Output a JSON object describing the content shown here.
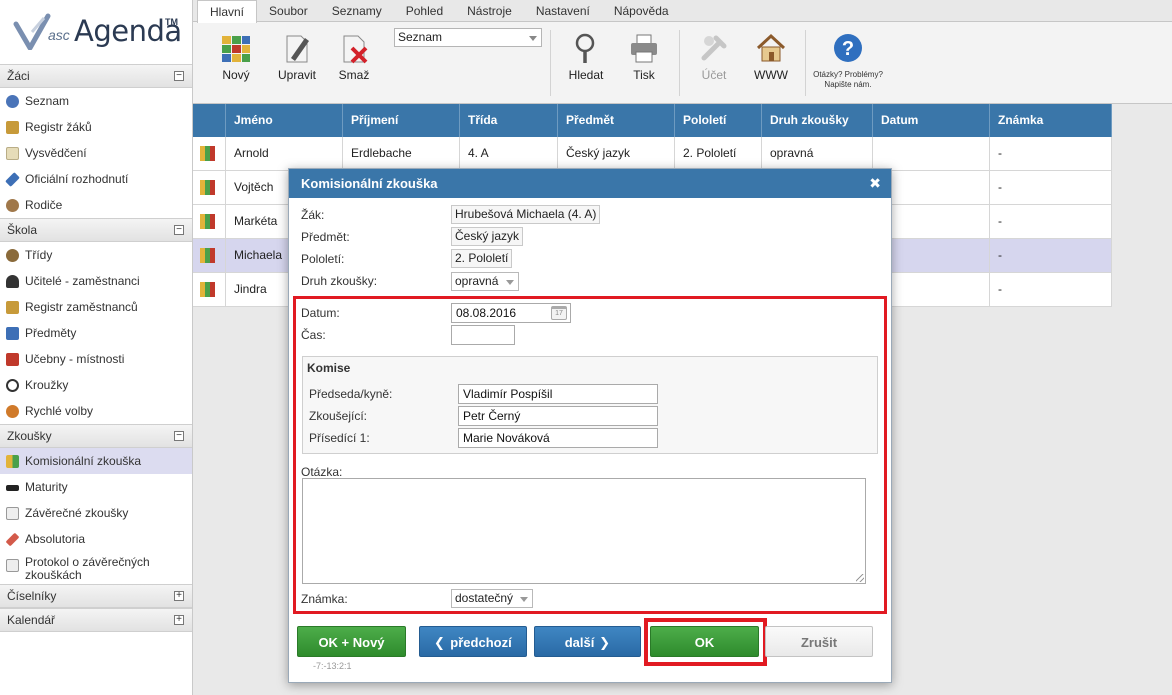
{
  "logo": {
    "asc": "asc",
    "agenda": "Agenda",
    "tm": "TM"
  },
  "sidebar": {
    "sections": [
      {
        "title": "Žáci",
        "toggle": "−",
        "items": [
          "Seznam",
          "Registr žáků",
          "Vysvědčení",
          "Oficiální rozhodnutí",
          "Rodiče"
        ]
      },
      {
        "title": "Škola",
        "toggle": "−",
        "items": [
          "Třídy",
          "Učitelé - zaměstnanci",
          "Registr zaměstnanců",
          "Předměty",
          "Učebny - místnosti",
          "Kroužky",
          "Rychlé volby"
        ]
      },
      {
        "title": "Zkoušky",
        "toggle": "−",
        "items": [
          "Komisionální zkouška",
          "Maturity",
          "Závěrečné zkoušky",
          "Absolutoria",
          "Protokol o závěrečných zkouškách"
        ]
      },
      {
        "title": "Číselníky",
        "toggle": "+",
        "items": []
      },
      {
        "title": "Kalendář",
        "toggle": "+",
        "items": []
      }
    ]
  },
  "menu": {
    "tabs": [
      "Hlavní",
      "Soubor",
      "Seznamy",
      "Pohled",
      "Nástroje",
      "Nastavení",
      "Nápověda"
    ]
  },
  "toolbar": {
    "new": "Nový",
    "edit": "Upravit",
    "delete": "Smaž",
    "view_select": "Seznam",
    "search": "Hledat",
    "print": "Tisk",
    "account": "Účet",
    "www": "WWW",
    "help_text": "Otázky? Problémy? Napište nám."
  },
  "grid": {
    "headers": [
      "",
      "Jméno",
      "Příjmení",
      "Třída",
      "Předmět",
      "Pololetí",
      "Druh zkoušky",
      "Datum",
      "Známka"
    ],
    "rows": [
      [
        "",
        "Arnold",
        "Erdlebache",
        "4. A",
        "Český jazyk",
        "2. Pololetí",
        "opravná",
        "",
        "-"
      ],
      [
        "",
        "Vojtěch",
        "",
        "",
        "",
        "",
        "",
        "",
        "-"
      ],
      [
        "",
        "Markéta",
        "",
        "",
        "",
        "",
        "",
        "",
        "-"
      ],
      [
        "",
        "Michaela",
        "",
        "",
        "",
        "",
        "",
        "",
        "-"
      ],
      [
        "",
        "Jindra",
        "",
        "",
        "",
        "",
        "",
        "",
        "-"
      ]
    ]
  },
  "dialog": {
    "title": "Komisionální zkouška",
    "close": "✖",
    "zak_label": "Žák:",
    "zak_value": "Hrubešová Michaela (4. A)",
    "predmet_label": "Předmět:",
    "predmet_value": "Český jazyk",
    "pololeti_label": "Pololetí:",
    "pololeti_value": "2. Pololetí",
    "druh_label": "Druh zkoušky:",
    "druh_value": "opravná",
    "datum_label": "Datum:",
    "datum_value": "08.08.2016",
    "cal_day": "17",
    "cas_label": "Čas:",
    "cas_value": "",
    "komise_title": "Komise",
    "predseda_label": "Předseda/kyně:",
    "predseda_value": "Vladimír Pospíšil",
    "zkousejici_label": "Zkoušející:",
    "zkousejici_value": "Petr Černý",
    "prisedici_label": "Přísedící 1:",
    "prisedici_value": "Marie Nováková",
    "otazka_label": "Otázka:",
    "otazka_value": "",
    "znamka_label": "Známka:",
    "znamka_value": "dostatečný",
    "btn_ok_new": "OK + Nový",
    "btn_prev": "předchozí",
    "btn_next": "další",
    "btn_ok": "OK",
    "btn_cancel": "Zrušit",
    "version": "-7:-13:2:1"
  },
  "colors": {
    "header_blue": "#3a76a9",
    "ok_green": "#2e8b2c",
    "highlight_red": "#e11a22",
    "selected_row": "#d6d6ee"
  }
}
